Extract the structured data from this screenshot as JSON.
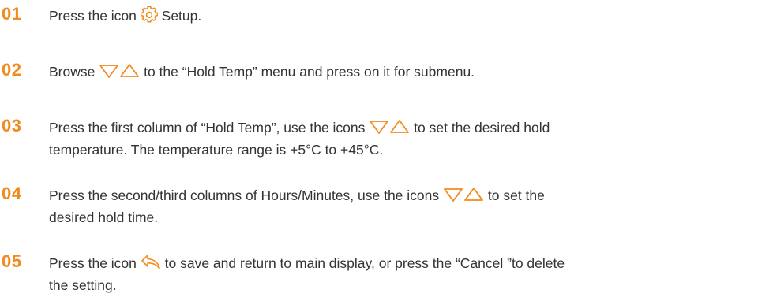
{
  "accent_color": "#f28b1e",
  "text_color": "#333333",
  "steps": [
    {
      "number": "01",
      "parts": [
        "Press the icon",
        "Setup."
      ],
      "icons": [
        "gear-icon"
      ]
    },
    {
      "number": "02",
      "parts": [
        "Browse",
        "to the “Hold Temp” menu and press on it for submenu."
      ],
      "icons": [
        "triangle-down-icon",
        "triangle-up-icon"
      ]
    },
    {
      "number": "03",
      "parts": [
        "Press the first column of “Hold Temp”, use the icons",
        "to set the desired hold",
        "temperature. The temperature range is +5°C to +45°C."
      ],
      "icons": [
        "triangle-down-icon",
        "triangle-up-icon"
      ]
    },
    {
      "number": "04",
      "parts": [
        "Press the second/third columns of Hours/Minutes, use the icons",
        "to set the",
        "desired hold time."
      ],
      "icons": [
        "triangle-down-icon",
        "triangle-up-icon"
      ]
    },
    {
      "number": "05",
      "parts": [
        "Press the icon",
        "to save and return to main display, or press the “Cancel ”to delete",
        "the setting."
      ],
      "icons": [
        "return-arrow-icon"
      ]
    }
  ]
}
